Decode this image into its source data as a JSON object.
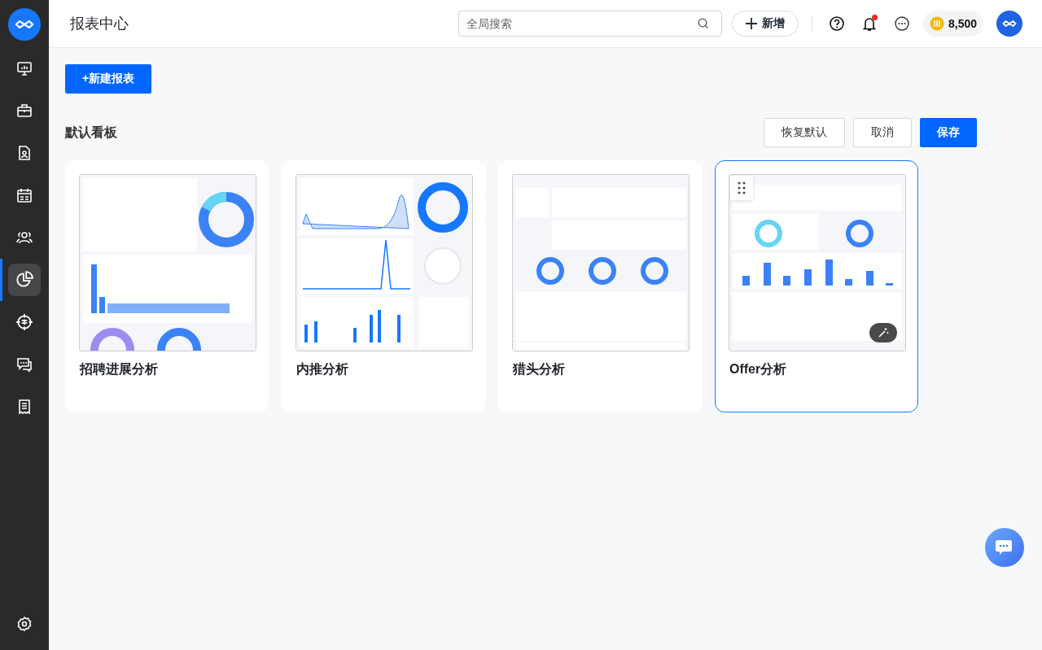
{
  "sidebar": {
    "items": [
      {
        "selected": false
      },
      {
        "selected": false
      },
      {
        "selected": false
      },
      {
        "selected": false
      },
      {
        "selected": false
      },
      {
        "selected": true
      },
      {
        "selected": false
      },
      {
        "selected": false
      },
      {
        "selected": false
      }
    ]
  },
  "header": {
    "title": "报表中心",
    "search": {
      "placeholder": "全局搜索"
    },
    "new_button": "新增",
    "notification_dot": true,
    "coins": "8,500"
  },
  "new_report_button": "+新建报表",
  "board": {
    "title": "默认看板",
    "buttons": [
      {
        "label": "恢复默认",
        "kind": "secondary"
      },
      {
        "label": "取消",
        "kind": "secondary"
      },
      {
        "label": "保存",
        "kind": "primary"
      }
    ],
    "cards": [
      {
        "title": "招聘进展分析",
        "selected": false
      },
      {
        "title": "内推分析",
        "selected": false
      },
      {
        "title": "猎头分析",
        "selected": false
      },
      {
        "title": "Offer分析",
        "selected": true
      }
    ]
  }
}
